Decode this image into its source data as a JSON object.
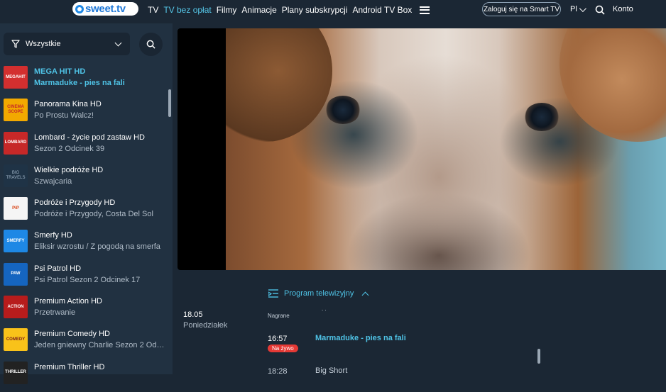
{
  "logo": {
    "text": "sweet.tv"
  },
  "nav": {
    "items": [
      {
        "label": "TV",
        "active": false
      },
      {
        "label": "TV bez opłat",
        "active": true
      },
      {
        "label": "Filmy",
        "active": false
      },
      {
        "label": "Animacje",
        "active": false
      },
      {
        "label": "Plany subskrypcji",
        "active": false
      },
      {
        "label": "Android TV Box",
        "active": false
      }
    ],
    "menu_icon": "hamburger-icon",
    "smart_tv_button": "Zaloguj się na Smart TV",
    "language": "Pl",
    "search_icon": "search-icon",
    "account": "Konto"
  },
  "sidebar": {
    "filter": {
      "value": "Wszystkie",
      "icon": "filter-icon"
    },
    "search_icon": "search-icon",
    "channels": [
      {
        "name": "MEGA HIT HD",
        "program": "Marmaduke - pies na fali",
        "logo": "MEGAHIT",
        "color": "#d32f2f",
        "active": true
      },
      {
        "name": "Panorama Kina HD",
        "program": "Po Prostu Walcz!",
        "logo": "CINEMA SCOPE",
        "color": "#f2a900",
        "active": false
      },
      {
        "name": "Lombard - życie pod zastaw HD",
        "program": "Sezon 2 Odcinek 39",
        "logo": "LOMBARD",
        "color": "#c62828",
        "active": false
      },
      {
        "name": "Wielkie podróże HD",
        "program": "Szwajcaria",
        "logo": "BIG TRAVELS",
        "color": "#1f3346",
        "active": false
      },
      {
        "name": "Podróże i Przygody HD",
        "program": "Podróże i Przygody, Costa Del Sol",
        "logo": "PiP",
        "color": "#f5f5f5",
        "active": false
      },
      {
        "name": "Smerfy HD",
        "program": "Eliksir wzrostu / Z pogodą na smerfa",
        "logo": "SMERFY",
        "color": "#1e88e5",
        "active": false
      },
      {
        "name": "Psi Patrol HD",
        "program": "Psi Patrol Sezon 2 Odcinek 17",
        "logo": "PAW",
        "color": "#1565c0",
        "active": false
      },
      {
        "name": "Premium Action HD",
        "program": "Przetrwanie",
        "logo": "ACTION",
        "color": "#b71c1c",
        "active": false
      },
      {
        "name": "Premium Comedy HD",
        "program": "Jeden gniewny Charlie Sezon 2 Odcinek 1",
        "logo": "COMEDY",
        "color": "#f9c21a",
        "active": false
      },
      {
        "name": "Premium Thriller HD",
        "program": "",
        "logo": "THRILLER",
        "color": "#222222",
        "active": false
      }
    ]
  },
  "program": {
    "toggle_label": "Program telewizyjny",
    "toggle_icon": "program-guide-icon",
    "date": "18.05",
    "day": "Poniedziałek",
    "recorded_label": "Nagrane",
    "dots": ". .",
    "rows": [
      {
        "time": "16:57",
        "title": "Marmaduke - pies na fali",
        "badge": "Na żywo"
      },
      {
        "time": "18:28",
        "title": "Big Short"
      }
    ]
  }
}
